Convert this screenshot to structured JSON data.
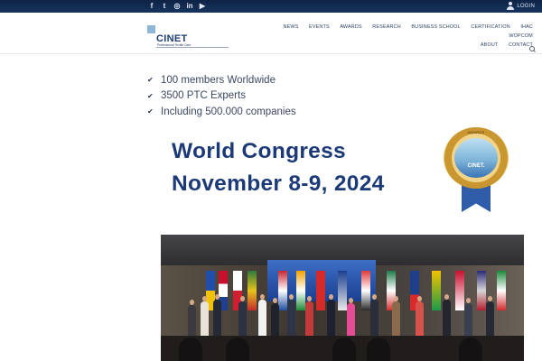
{
  "topbar": {
    "social_icons": [
      "facebook-icon",
      "twitter-icon",
      "instagram-icon",
      "linkedin-icon",
      "youtube-icon"
    ],
    "login_label": "LOGIN"
  },
  "logo": {
    "name": "CINET",
    "tagline": "Professional Textile Care"
  },
  "nav": {
    "items": [
      "NEWS",
      "EVENTS",
      "AWARDS",
      "RESEARCH",
      "BUSINESS SCHOOL",
      "CERTIFICATION",
      "IHAC",
      "WOPCOM",
      "ABOUT",
      "CONTACT"
    ]
  },
  "features": [
    "100 members Worldwide",
    "3500 PTC Experts",
    "Including 500.000 companies"
  ],
  "banner": {
    "line1": "World Congress",
    "line2": "November 8-9, 2024",
    "badge_arc": "AWARDS",
    "badge_brand": "CINET."
  },
  "colors": {
    "topbar": "#0d2346",
    "heading": "#1d3a78",
    "text": "#3b4862"
  }
}
